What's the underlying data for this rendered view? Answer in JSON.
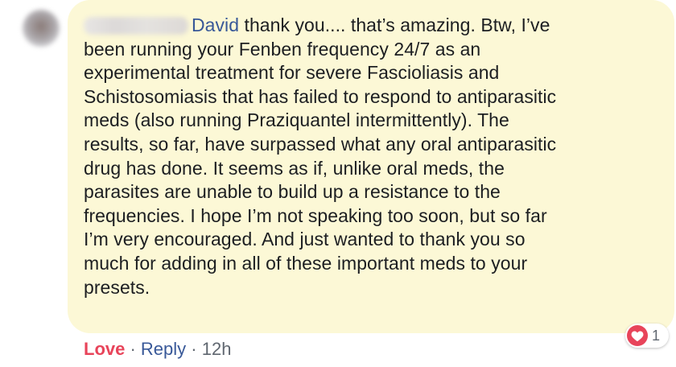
{
  "comment": {
    "mention": "David",
    "first_line": " thank you.... that’s amazing. Btw, I’ve",
    "body_lines": [
      "been running your Fenben frequency 24/7 as an",
      "experimental treatment for severe Fascioliasis and",
      "Schistosomiasis that has failed to respond to antiparasitic",
      "meds (also running Praziquantel intermittently). The",
      "results, so far, have surpassed what any oral antiparasitic",
      "drug has done. It seems as if, unlike oral meds, the",
      "parasites are unable to build up a resistance to the",
      "frequencies. I hope I’m not speaking too soon, but so far",
      "I’m very encouraged. And just wanted to thank you so",
      "much for adding in all of these important meds to your",
      "presets."
    ]
  },
  "reactions": {
    "icon": "heart-icon",
    "count": "1"
  },
  "actions": {
    "love_label": "Love",
    "separator": " · ",
    "reply_label": "Reply",
    "timestamp": "12h"
  },
  "colors": {
    "bubble_bg": "#fcf8d6",
    "mention": "#385898",
    "love": "#e8445a",
    "meta": "#606770"
  }
}
